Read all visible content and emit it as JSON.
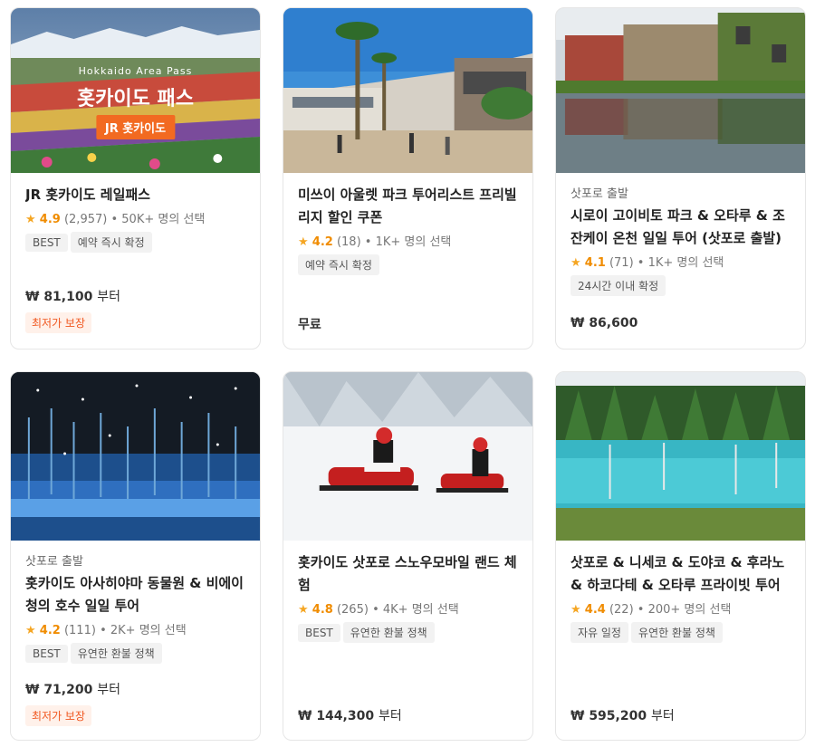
{
  "cards": [
    {
      "title": "JR 홋카이도 레일패스",
      "rating": "4.9",
      "reviews": "(2,957)",
      "selected": "• 50K+ 명의 선택",
      "tags": [
        "BEST",
        "예약 즉시 확정"
      ],
      "price": "₩ 81,100",
      "price_suffix": "부터",
      "promo": "최저가 보장",
      "thumb_overlay": {
        "subtitle": "Hokkaido Area Pass",
        "title": "홋카이도 패스",
        "badge": "JR 홋카이도"
      }
    },
    {
      "title": "미쓰이 아울렛 파크 투어리스트 프리빌리지 할인 쿠폰",
      "rating": "4.2",
      "reviews": "(18)",
      "selected": "• 1K+ 명의 선택",
      "tags": [
        "예약 즉시 확정"
      ],
      "price": "무료",
      "price_suffix": ""
    },
    {
      "origin": "삿포로 출발",
      "title": "시로이 고이비토 파크 & 오타루 & 조잔케이 온천 일일 투어 (삿포로 출발)",
      "rating": "4.1",
      "reviews": "(71)",
      "selected": "• 1K+ 명의 선택",
      "tags": [
        "24시간 이내 확정"
      ],
      "price": "₩ 86,600",
      "price_suffix": ""
    },
    {
      "origin": "삿포로 출발",
      "title": "홋카이도 아사히야마 동물원 & 비에이 청의 호수 일일 투어",
      "rating": "4.2",
      "reviews": "(111)",
      "selected": "• 2K+ 명의 선택",
      "tags": [
        "BEST",
        "유연한 환불 정책"
      ],
      "price": "₩ 71,200",
      "price_suffix": "부터",
      "promo": "최저가 보장"
    },
    {
      "title": "홋카이도 삿포로 스노우모바일 랜드 체험",
      "rating": "4.8",
      "reviews": "(265)",
      "selected": "• 4K+ 명의 선택",
      "tags": [
        "BEST",
        "유연한 환불 정책"
      ],
      "price": "₩ 144,300",
      "price_suffix": "부터"
    },
    {
      "title": "삿포로 & 니세코 & 도야코 & 후라노 & 하코다테 & 오타루 프라이빗 투어",
      "rating": "4.4",
      "reviews": "(22)",
      "selected": "• 200+ 명의 선택",
      "tags": [
        "자유 일정",
        "유연한 환불 정책"
      ],
      "price": "₩ 595,200",
      "price_suffix": "부터"
    }
  ],
  "icons": {
    "star": "star-icon"
  },
  "colors": {
    "star": "#f5a623",
    "promo": "#f0561e",
    "promo_bg": "#fff1ea",
    "tag_bg": "#f2f2f2",
    "badge": "#f26a21"
  }
}
